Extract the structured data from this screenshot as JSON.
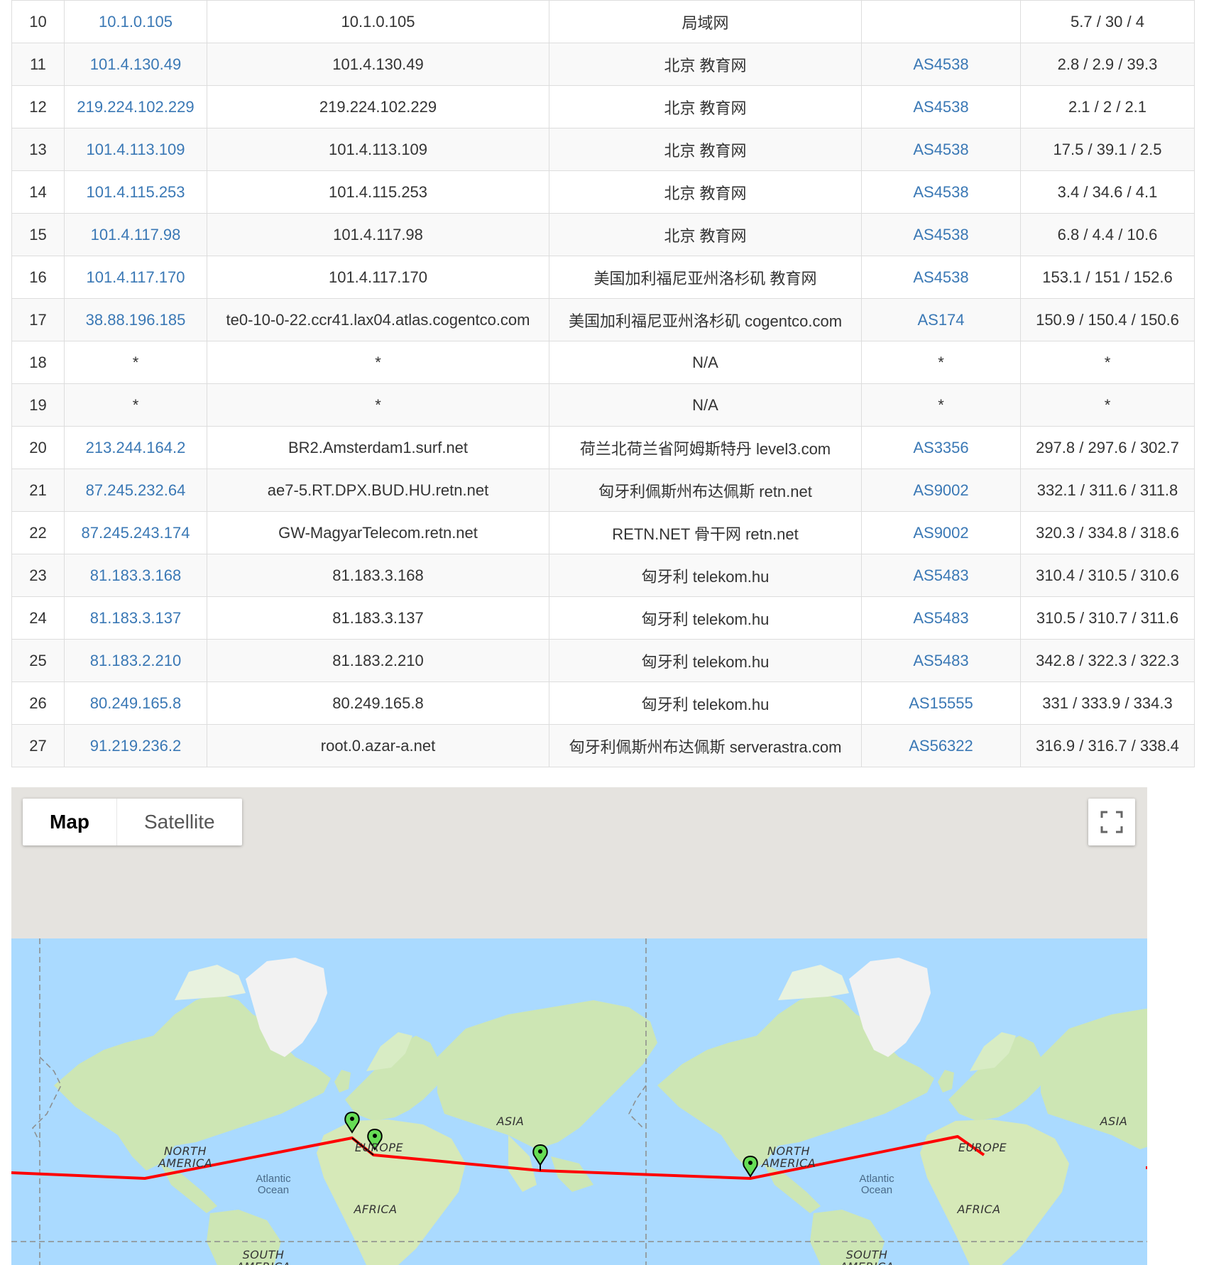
{
  "hops": [
    {
      "hop": "10",
      "ip": "10.1.0.105",
      "host": "10.1.0.105",
      "location": "局域网",
      "asn": "",
      "latency": "5.7 / 30 / 4"
    },
    {
      "hop": "11",
      "ip": "101.4.130.49",
      "host": "101.4.130.49",
      "location": "北京 教育网",
      "asn": "AS4538",
      "latency": "2.8 / 2.9 / 39.3"
    },
    {
      "hop": "12",
      "ip": "219.224.102.229",
      "host": "219.224.102.229",
      "location": "北京 教育网",
      "asn": "AS4538",
      "latency": "2.1 / 2 / 2.1"
    },
    {
      "hop": "13",
      "ip": "101.4.113.109",
      "host": "101.4.113.109",
      "location": "北京 教育网",
      "asn": "AS4538",
      "latency": "17.5 / 39.1 / 2.5"
    },
    {
      "hop": "14",
      "ip": "101.4.115.253",
      "host": "101.4.115.253",
      "location": "北京 教育网",
      "asn": "AS4538",
      "latency": "3.4 / 34.6 / 4.1"
    },
    {
      "hop": "15",
      "ip": "101.4.117.98",
      "host": "101.4.117.98",
      "location": "北京 教育网",
      "asn": "AS4538",
      "latency": "6.8 / 4.4 / 10.6"
    },
    {
      "hop": "16",
      "ip": "101.4.117.170",
      "host": "101.4.117.170",
      "location": "美国加利福尼亚州洛杉矶 教育网",
      "asn": "AS4538",
      "latency": "153.1 / 151 / 152.6"
    },
    {
      "hop": "17",
      "ip": "38.88.196.185",
      "host": "te0-10-0-22.ccr41.lax04.atlas.cogentco.com",
      "location": "美国加利福尼亚州洛杉矶 cogentco.com",
      "asn": "AS174",
      "latency": "150.9 / 150.4 / 150.6"
    },
    {
      "hop": "18",
      "ip": "*",
      "host": "*",
      "location": "N/A",
      "asn": "*",
      "latency": "*"
    },
    {
      "hop": "19",
      "ip": "*",
      "host": "*",
      "location": "N/A",
      "asn": "*",
      "latency": "*"
    },
    {
      "hop": "20",
      "ip": "213.244.164.2",
      "host": "BR2.Amsterdam1.surf.net",
      "location": "荷兰北荷兰省阿姆斯特丹 level3.com",
      "asn": "AS3356",
      "latency": "297.8 / 297.6 / 302.7"
    },
    {
      "hop": "21",
      "ip": "87.245.232.64",
      "host": "ae7-5.RT.DPX.BUD.HU.retn.net",
      "location": "匈牙利佩斯州布达佩斯 retn.net",
      "asn": "AS9002",
      "latency": "332.1 / 311.6 / 311.8"
    },
    {
      "hop": "22",
      "ip": "87.245.243.174",
      "host": "GW-MagyarTelecom.retn.net",
      "location": "RETN.NET 骨干网 retn.net",
      "asn": "AS9002",
      "latency": "320.3 / 334.8 / 318.6"
    },
    {
      "hop": "23",
      "ip": "81.183.3.168",
      "host": "81.183.3.168",
      "location": "匈牙利 telekom.hu",
      "asn": "AS5483",
      "latency": "310.4 / 310.5 / 310.6"
    },
    {
      "hop": "24",
      "ip": "81.183.3.137",
      "host": "81.183.3.137",
      "location": "匈牙利 telekom.hu",
      "asn": "AS5483",
      "latency": "310.5 / 310.7 / 311.6"
    },
    {
      "hop": "25",
      "ip": "81.183.2.210",
      "host": "81.183.2.210",
      "location": "匈牙利 telekom.hu",
      "asn": "AS5483",
      "latency": "342.8 / 322.3 / 322.3"
    },
    {
      "hop": "26",
      "ip": "80.249.165.8",
      "host": "80.249.165.8",
      "location": "匈牙利 telekom.hu",
      "asn": "AS15555",
      "latency": "331 / 333.9 / 334.3"
    },
    {
      "hop": "27",
      "ip": "91.219.236.2",
      "host": "root.0.azar-a.net",
      "location": "匈牙利佩斯州布达佩斯 serverastra.com",
      "asn": "AS56322",
      "latency": "316.9 / 316.7 / 338.4"
    }
  ],
  "map": {
    "type_map_label": "Map",
    "type_satellite_label": "Satellite",
    "fullscreen_icon": "fullscreen-icon",
    "labels": {
      "north_america": "NORTH AMERICA",
      "europe": "EUROPE",
      "asia": "ASIA",
      "africa": "AFRICA",
      "south_america": "SOUTH AMERICA",
      "atlantic": "Atlantic Ocean"
    },
    "colors": {
      "ocean": "#aadaff",
      "land": "#cde6b4",
      "ice": "#f2f2f2",
      "route": "#ff0000",
      "marker": "#66dd55",
      "link": "#3a78b5"
    }
  }
}
